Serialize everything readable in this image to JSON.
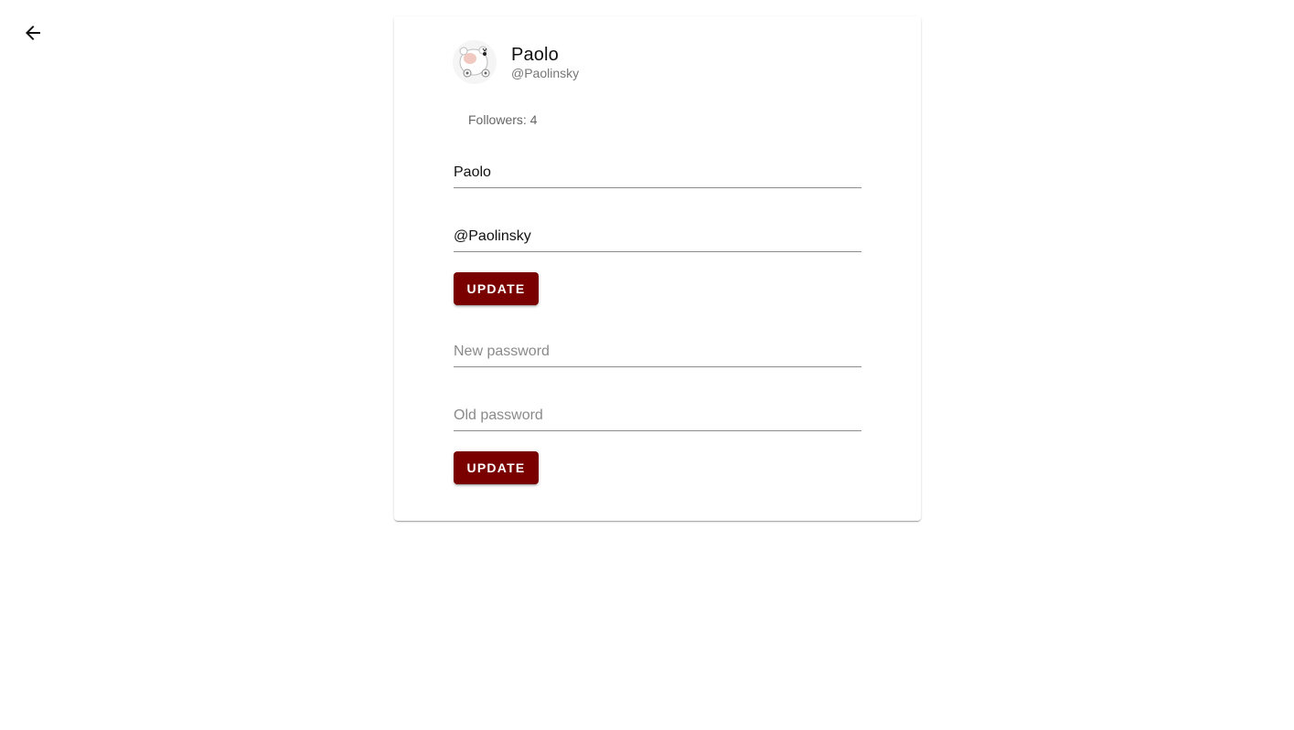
{
  "nav": {
    "back_icon": "arrow-left-icon"
  },
  "profile": {
    "avatar_icon": "bear-avatar",
    "display_name": "Paolo",
    "handle": "@Paolinsky",
    "followers_text": "Followers: 4"
  },
  "profile_form": {
    "name_value": "Paolo",
    "handle_value": "@Paolinsky",
    "update_label": "UPDATE"
  },
  "password_form": {
    "new_password_placeholder": "New password",
    "old_password_placeholder": "Old password",
    "update_label": "UPDATE"
  },
  "colors": {
    "accent": "#7a0000",
    "background": "#ffffff"
  }
}
